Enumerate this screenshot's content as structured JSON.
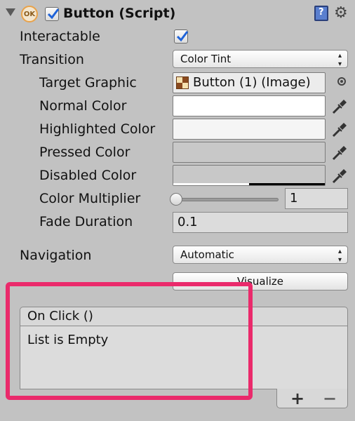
{
  "header": {
    "title": "Button (Script)",
    "enabled": true,
    "icon": "ok-icon"
  },
  "fields": {
    "interactable": {
      "label": "Interactable",
      "checked": true
    },
    "transition": {
      "label": "Transition",
      "value": "Color Tint"
    },
    "target_graphic": {
      "label": "Target Graphic",
      "value": "Button (1) (Image)"
    },
    "normal_color": {
      "label": "Normal Color",
      "color": "#FFFFFF"
    },
    "highlighted_color": {
      "label": "Highlighted Color",
      "color": "#F5F5F5"
    },
    "pressed_color": {
      "label": "Pressed Color",
      "color": "#C8C8C8"
    },
    "disabled_color": {
      "label": "Disabled Color",
      "color": "#C8C8C8",
      "alpha": 0.5
    },
    "color_multiplier": {
      "label": "Color Multiplier",
      "value": "1",
      "slider_fraction": 0.0
    },
    "fade_duration": {
      "label": "Fade Duration",
      "value": "0.1"
    },
    "navigation": {
      "label": "Navigation",
      "value": "Automatic"
    }
  },
  "buttons": {
    "visualize": "Visualize"
  },
  "on_click": {
    "header": "On Click ()",
    "empty_text": "List is Empty",
    "add_label": "+",
    "remove_label": "−"
  },
  "colors": {
    "highlight_border": "#EA2A6B",
    "panel_bg": "#C2C2C2"
  }
}
